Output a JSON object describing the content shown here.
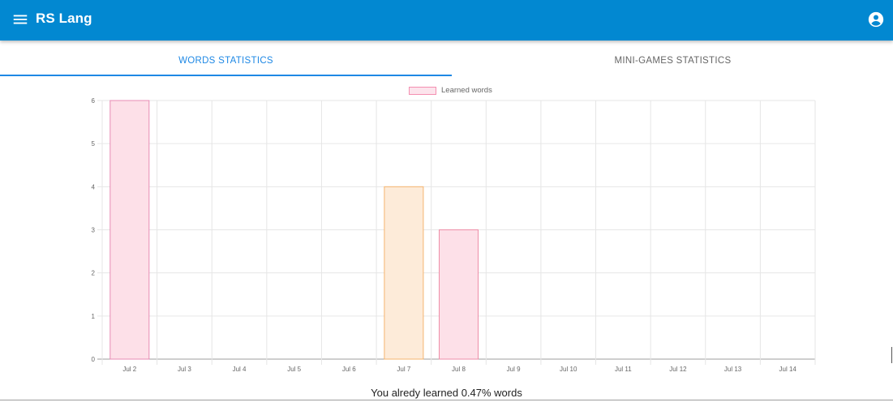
{
  "app": {
    "title": "RS Lang"
  },
  "icons": {
    "menu": "menu-icon",
    "account": "account-circle-icon"
  },
  "colors": {
    "appbar": "#0288d1",
    "tab_active": "#1e88e5"
  },
  "tabs": [
    {
      "label": "WORDS STATISTICS",
      "active": true
    },
    {
      "label": "MINI-GAMES STATISTICS",
      "active": false
    }
  ],
  "chart_data": {
    "type": "bar",
    "legend": [
      "Learned words"
    ],
    "legend_position": "top-center",
    "categories": [
      "Jul 2",
      "Jul 3",
      "Jul 4",
      "Jul 5",
      "Jul 6",
      "Jul 7",
      "Jul 8",
      "Jul 9",
      "Jul 10",
      "Jul 11",
      "Jul 12",
      "Jul 13",
      "Jul 14"
    ],
    "series": [
      {
        "name": "Learned words",
        "values": [
          6,
          0,
          0,
          0,
          0,
          4,
          3,
          0,
          0,
          0,
          0,
          0,
          0
        ],
        "fill_colors": [
          "#fde0e8",
          "#fde0e8",
          "#fde0e8",
          "#fde0e8",
          "#fde0e8",
          "#fdebd9",
          "#fde0e8",
          "#fde0e8",
          "#fde0e8",
          "#fde0e8",
          "#fde0e8",
          "#fde0e8",
          "#fde0e8"
        ],
        "border_colors": [
          "#e88bb4",
          "#e88bb4",
          "#e88bb4",
          "#e88bb4",
          "#e88bb4",
          "#f5b46f",
          "#ee8ea8",
          "#e88bb4",
          "#e88bb4",
          "#e88bb4",
          "#e88bb4",
          "#e88bb4",
          "#e88bb4"
        ]
      }
    ],
    "ylim": [
      0,
      6
    ],
    "yticks": [
      "0",
      "1",
      "2",
      "3",
      "4",
      "5",
      "6"
    ],
    "grid": true
  },
  "summary": {
    "text": "You alredy learned 0.47% words"
  }
}
